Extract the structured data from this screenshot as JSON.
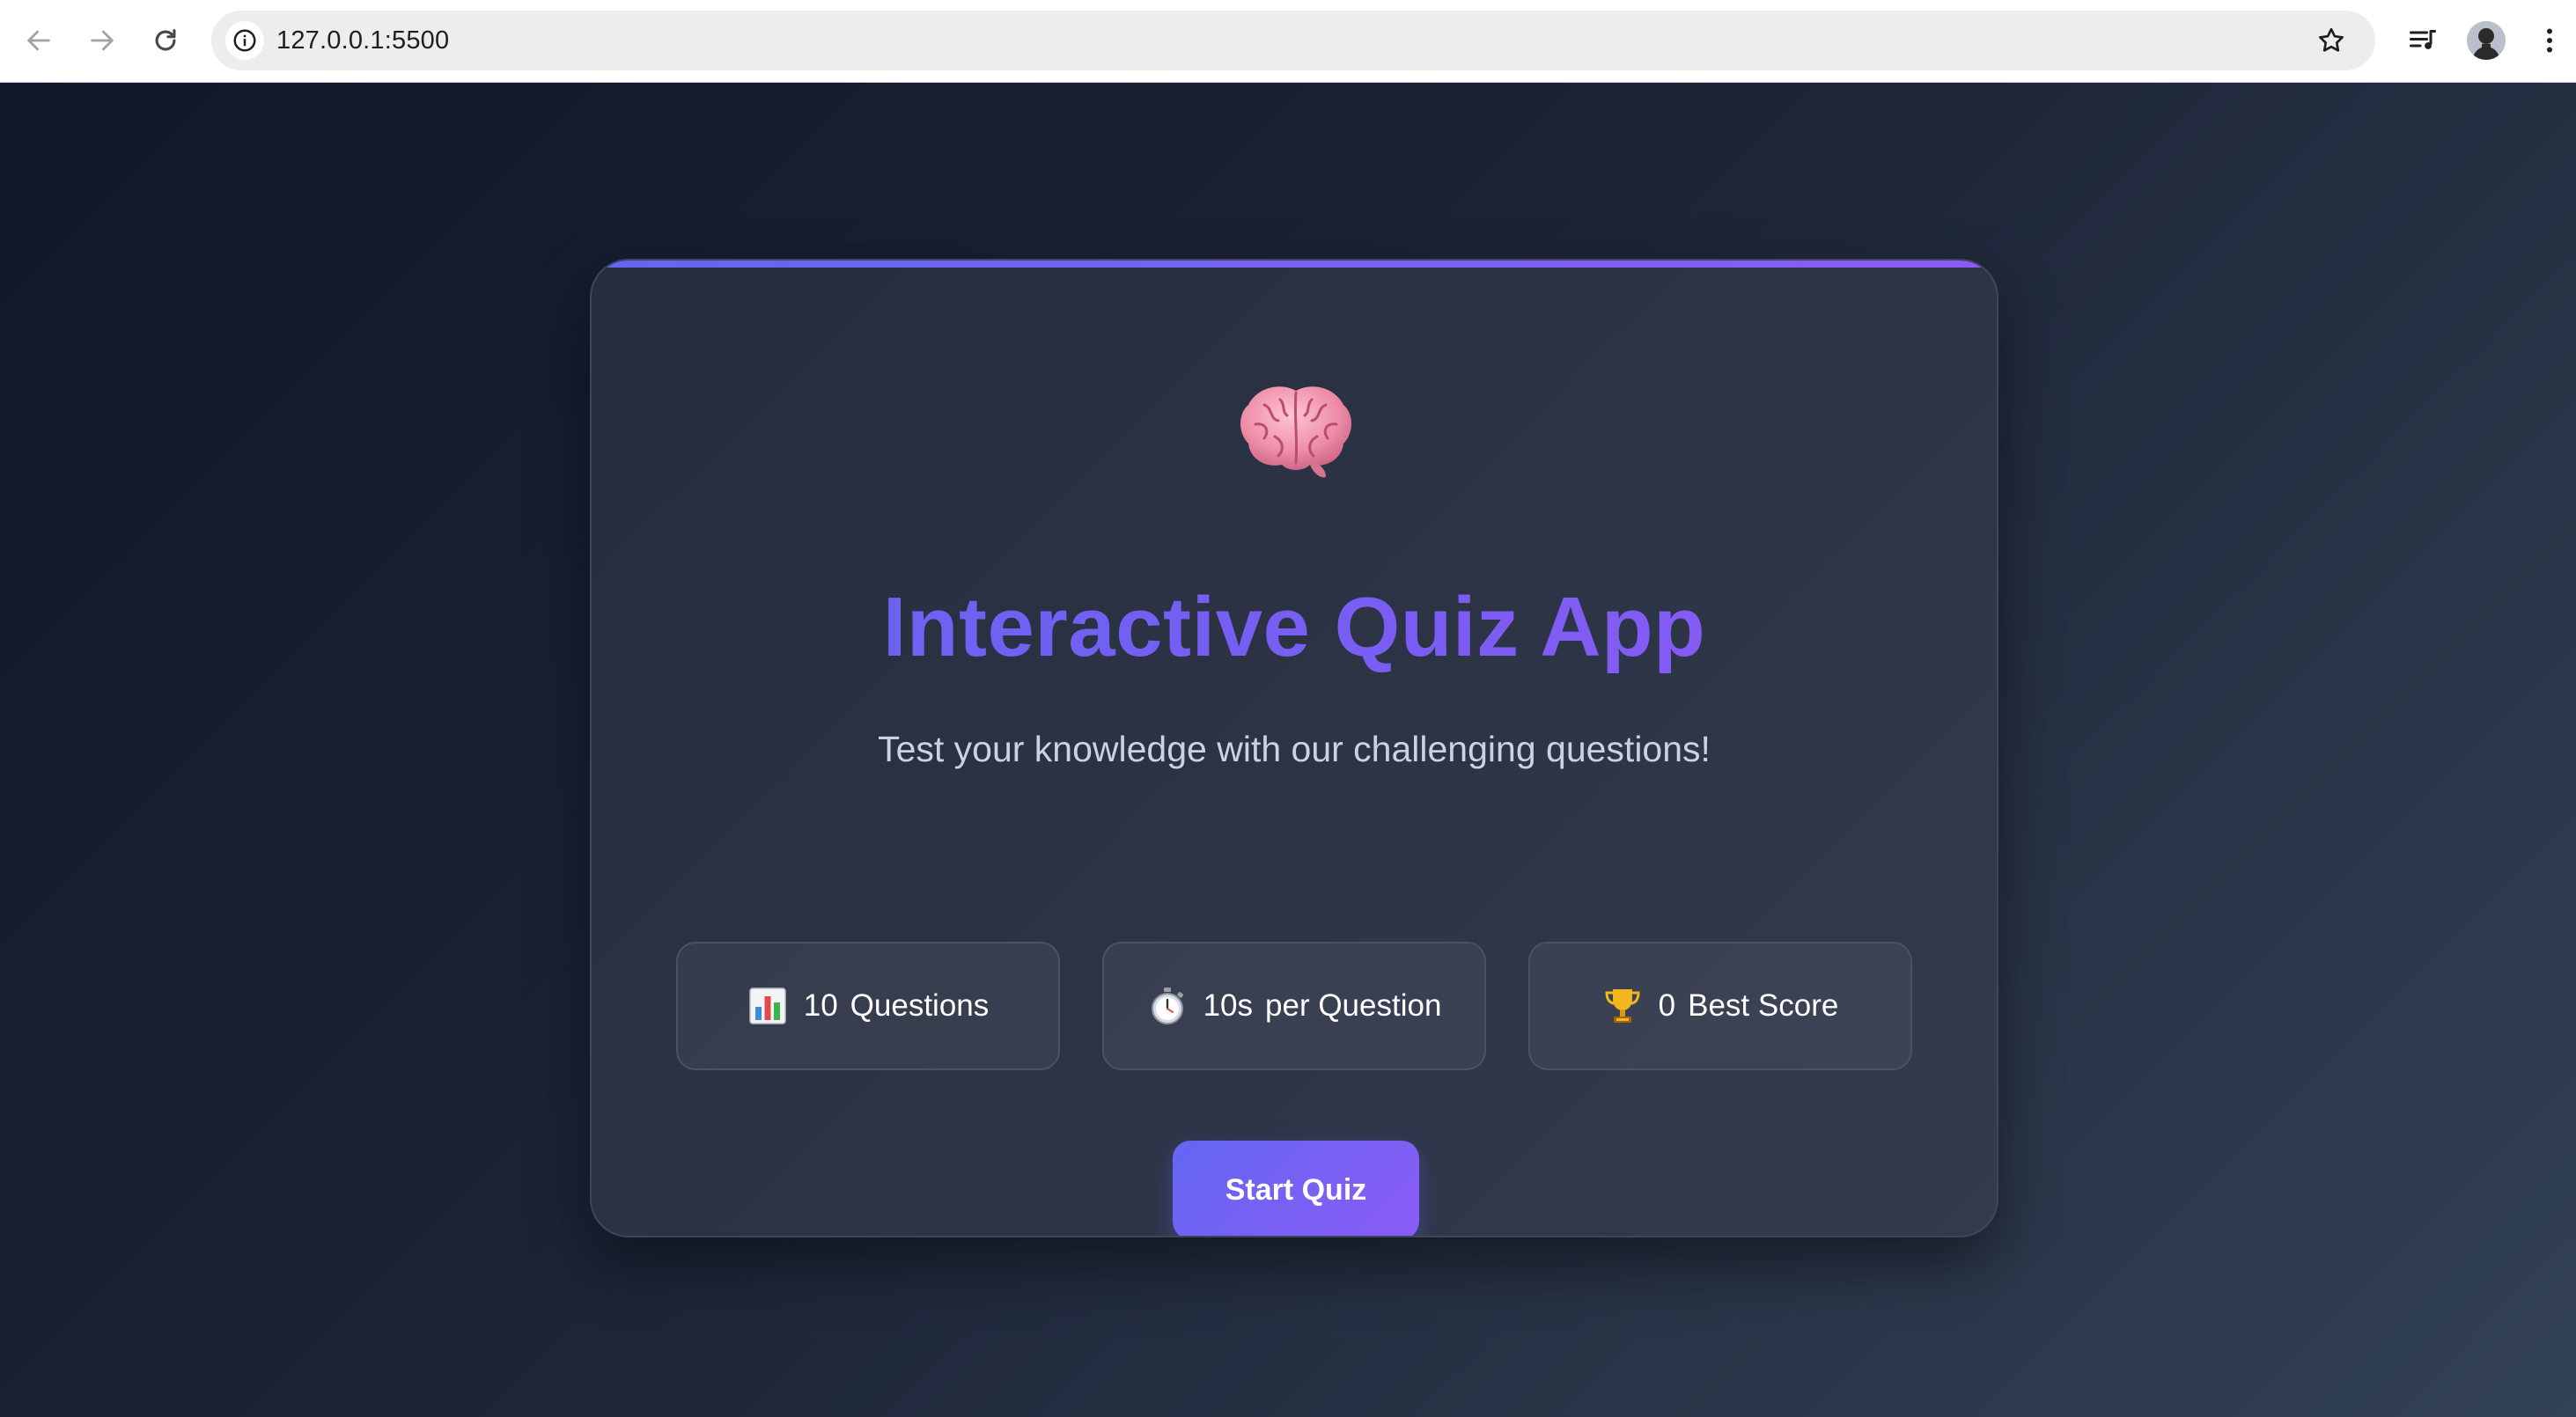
{
  "browser": {
    "url": "127.0.0.1:5500",
    "icons": [
      "back-arrow-icon",
      "forward-arrow-icon",
      "reload-icon",
      "info-icon",
      "star-icon",
      "media-control-icon",
      "profile-avatar",
      "more-menu-icon"
    ]
  },
  "hero": {
    "icon": "brain-icon",
    "title": "Interactive Quiz App",
    "subtitle": "Test your knowledge with our challenging questions!"
  },
  "stats": [
    {
      "icon": "bar-chart-icon",
      "value": "10",
      "label": "Questions"
    },
    {
      "icon": "stopwatch-icon",
      "value": "10s",
      "label": "per Question"
    },
    {
      "icon": "trophy-icon",
      "value": "0",
      "label": "Best Score"
    }
  ],
  "start_button": {
    "label": "Start Quiz"
  },
  "colors": {
    "accent_start": "#6366f1",
    "accent_end": "#8b5cf6",
    "background_dark": "#0f172a",
    "card": "#2b3345"
  }
}
